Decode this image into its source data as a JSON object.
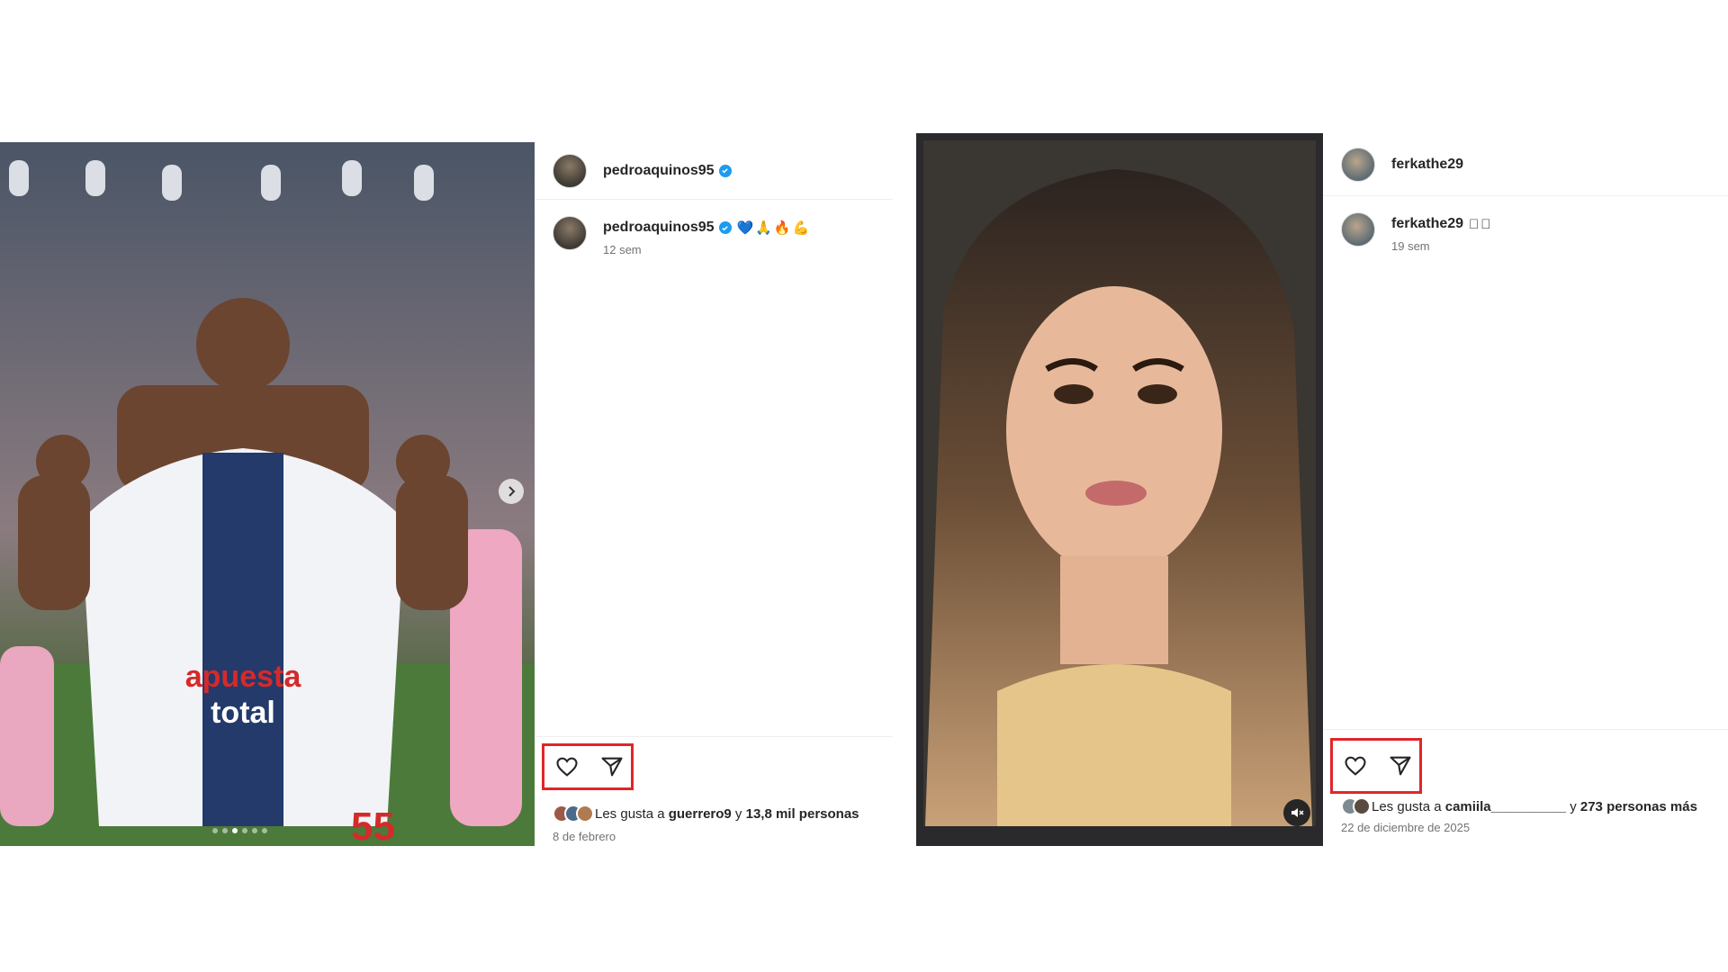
{
  "posts": [
    {
      "username": "pedroaquinos95",
      "verified": true,
      "caption_emojis": "💙🙏🔥💪",
      "time_ago": "12 sem",
      "likes_prefix": "Les gusta a ",
      "likes_user": "guerrero9",
      "likes_mid": " y ",
      "likes_count": "13,8 mil personas",
      "likes_suffix": "",
      "date": "8 de febrero",
      "media": {
        "type": "photo-carousel",
        "slides": 6,
        "active_slide": 2
      }
    },
    {
      "username": "ferkathe29",
      "verified": false,
      "caption_emojis": "􀀀􀀀",
      "time_ago": "19 sem",
      "likes_prefix": "Les gusta a ",
      "likes_user": "camiila__________",
      "likes_mid": " y ",
      "likes_count": "273 personas más",
      "likes_suffix": "",
      "date": "22 de diciembre de 2025",
      "media": {
        "type": "video",
        "muted": true
      }
    }
  ],
  "icons": [
    "heart-icon",
    "share-icon",
    "verified-badge-icon",
    "chevron-right-icon",
    "mute-icon"
  ],
  "colors": {
    "highlight_box": "#e0262a",
    "verified": "#1d9bf0",
    "secondary_text": "#737373"
  }
}
